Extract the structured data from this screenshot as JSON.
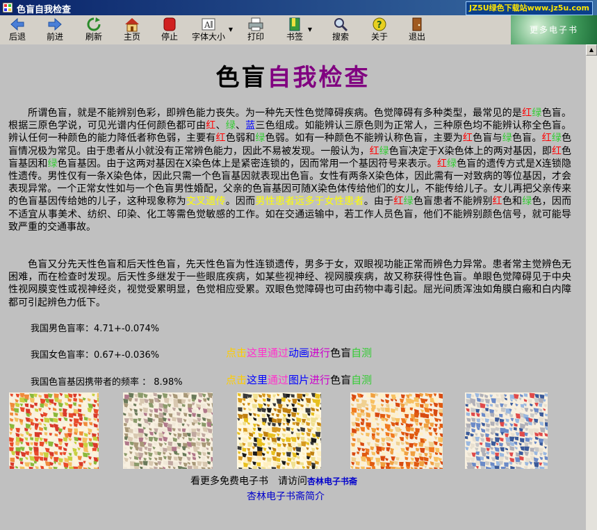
{
  "window": {
    "title": "色盲自我检查",
    "ad_text": "JZ5U绿色下载站www.jz5u.com"
  },
  "toolbar": {
    "items": [
      {
        "label": "后退",
        "icon": "back-arrow-icon"
      },
      {
        "label": "前进",
        "icon": "forward-arrow-icon"
      },
      {
        "label": "刷新",
        "icon": "refresh-icon"
      },
      {
        "label": "主页",
        "icon": "home-icon"
      },
      {
        "label": "停止",
        "icon": "stop-icon"
      },
      {
        "label": "字体大小",
        "icon": "font-size-icon"
      },
      {
        "label": "打印",
        "icon": "print-icon"
      },
      {
        "label": "书签",
        "icon": "bookmark-icon"
      },
      {
        "label": "搜索",
        "icon": "search-icon"
      },
      {
        "label": "关于",
        "icon": "help-icon"
      },
      {
        "label": "退出",
        "icon": "exit-door-icon"
      }
    ],
    "banner_text": "更多电子书"
  },
  "heading": {
    "part1": "色盲",
    "part2": "自我检查",
    "color1": "#000000",
    "color2": "#800080"
  },
  "para1": [
    "所谓色盲，就是不能辨别色彩，即辨色能力丧失。为一种先天性色觉障碍疾病。色觉障碍有多种类型，最常见的是",
    "红",
    "绿",
    "色盲。根据三原色学说，可见光谱内任何颜色都可由",
    "红",
    "、",
    "绿",
    "、",
    "蓝",
    "三色组成。如能辨认三原色则为正常人，三种原色均不能辨认称全色盲。辨认任何一种颜色的能力降低者称色弱，主要有",
    "红",
    "色弱和",
    "绿",
    "色弱。如有一种颜色不能辨认称色盲，主要为",
    "红",
    "色盲与",
    "绿",
    "色盲。",
    "红",
    "绿",
    "色盲情况极为常见。由于患者从小就没有正常辨色能力，因此不易被发现。一般认为，",
    "红",
    "绿",
    "色盲决定于X染色体上的两对基因，即",
    "红",
    "色盲基因和",
    "绿",
    "色盲基因。由于这两对基因在X染色体上是紧密连锁的，因而常用一个基因符号来表示。",
    "红",
    "绿",
    "色盲的遗传方式是X连锁隐性遗传。男性仅有一条X染色体，因此只需一个色盲基因就表现出色盲。女性有两条X染色体，因此需有一对致病的等位基因，才会表现异常。一个正常女性如与一个色盲男性婚配，父亲的色盲基因可随X染色体传给他们的女儿，不能传给儿子。女儿再把父亲传来的色盲基因传给她的儿子，这种现象称为",
    "交叉遗传",
    "。因而",
    "男性患者远多于女性患者",
    "。由于",
    "红",
    "绿",
    "色盲患者不能辨别",
    "红",
    "色和",
    "绿",
    "色，因而不适宜从事美术、纺织、印染、化工等需色觉敏感的工作。如在交通运输中，若工作人员色盲，他们不能辨别颜色信号，就可能导致严重的交通事故。"
  ],
  "para2": "色盲又分先天性色盲和后天性色盲，先天性色盲为性连锁遗传，男多于女，双眼视功能正常而辨色力异常。患者常主觉辨色无困难，而在检查时发现。后天性多继发于一些眼底疾病，如某些视神经、视网膜疾病，故又称获得性色盲。单眼色觉障碍见于中央性视网膜变性或视神经炎，视觉受累明显，色觉相应受累。双眼色觉障碍也可由药物中毒引起。屈光间质浑浊如角膜白瘢和白内障都可引起辨色力低下。",
  "stats": {
    "male": "我国男色盲率：4.71+-0.074%",
    "female": "我国女色盲率：0.67+-0.036%",
    "carrier": "我国色盲基因携带者的频率 ： 8.98%"
  },
  "links": {
    "animation": [
      "点击",
      "这里",
      "通过",
      "动画",
      "进行",
      "色盲",
      "自测"
    ],
    "pictures": [
      "点击",
      "这里",
      "通过",
      "图片",
      "进行",
      "色盲",
      "自测"
    ]
  },
  "footer": {
    "prefix": "看更多免费电子书　请访问",
    "site": "杏林电子书斋",
    "intro": "杏林电子书斋简介"
  },
  "colors": {
    "title_bar": "#0a246a",
    "background": "#c0c0c0",
    "red": "#ff0000",
    "green": "#33cc33",
    "blue": "#0000ff",
    "yellow": "#ffff00"
  }
}
